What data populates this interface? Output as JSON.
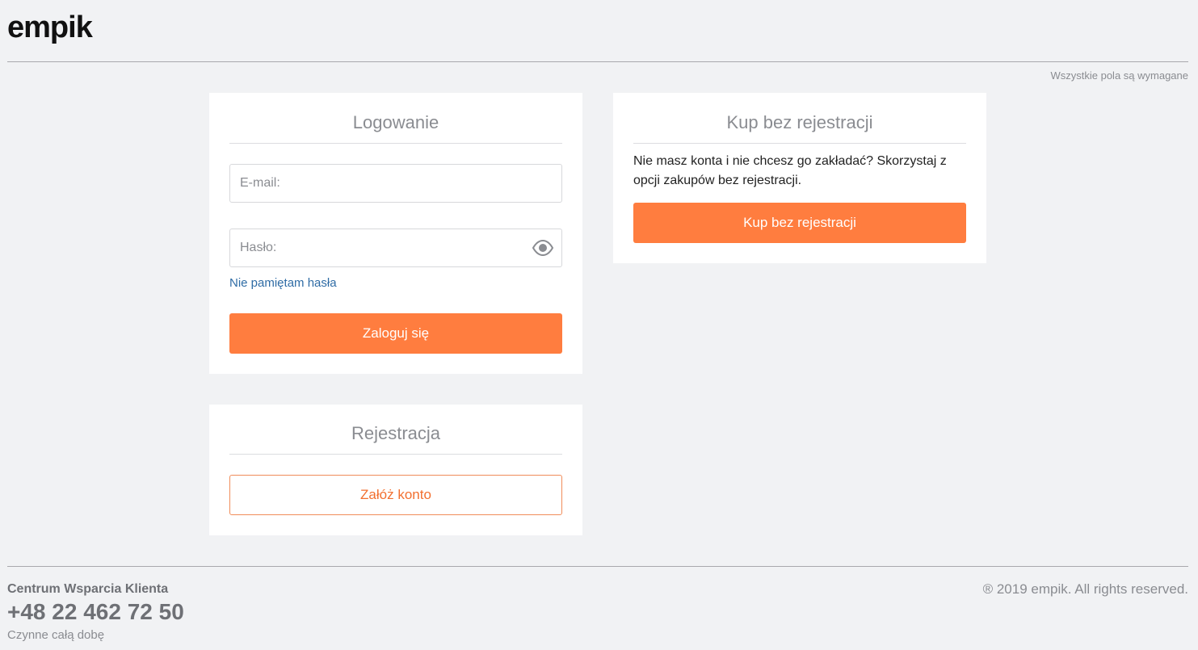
{
  "header": {
    "logo_text": "empik",
    "required_note": "Wszystkie pola są wymagane"
  },
  "login": {
    "title": "Logowanie",
    "email_placeholder": "E-mail:",
    "password_placeholder": "Hasło:",
    "show_password_icon": "eye-icon",
    "forgot_link": "Nie pamiętam hasła",
    "submit_label": "Zaloguj się"
  },
  "register": {
    "title": "Rejestracja",
    "create_account_label": "Załóż konto"
  },
  "guest": {
    "title": "Kup bez rejestracji",
    "description": "Nie masz konta i nie chcesz go zakładać? Skorzystaj z opcji zakupów bez rejestracji.",
    "button_label": "Kup bez rejestracji"
  },
  "footer": {
    "support_title": "Centrum Wsparcia Klienta",
    "support_phone": "+48 22 462 72 50",
    "support_hours": "Czynne całą dobę",
    "copyright": "® 2019 empik. All rights reserved."
  },
  "colors": {
    "accent": "#ff7d3f",
    "link": "#2f6ca5",
    "background": "#f1f2f4"
  }
}
